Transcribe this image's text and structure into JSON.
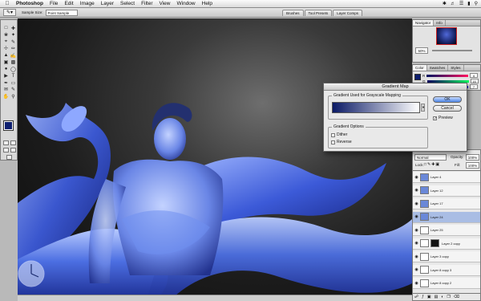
{
  "menubar": {
    "apple": "",
    "app_name": "Photoshop",
    "items": [
      "File",
      "Edit",
      "Image",
      "Layer",
      "Select",
      "Filter",
      "View",
      "Window",
      "Help"
    ]
  },
  "options_bar": {
    "sample_size_label": "Sample Size:",
    "sample_size_value": "Point Sample",
    "palette_wells": [
      "Brushes",
      "Tool Presets",
      "Layer Comps"
    ]
  },
  "navigator": {
    "tabs": [
      "Navigator",
      "Info"
    ],
    "zoom": "50%"
  },
  "color_panel": {
    "tabs": [
      "Color",
      "Swatches",
      "Styles"
    ],
    "channels": [
      {
        "label": "R",
        "value": "6"
      },
      {
        "label": "G",
        "value": "16"
      },
      {
        "label": "B",
        "value": "7"
      }
    ]
  },
  "layers_panel": {
    "tabs": [
      "Layers",
      "Channels",
      "Paths"
    ],
    "blend_mode": "Normal",
    "opacity_label": "Opacity:",
    "opacity_value": "100%",
    "lock_label": "Lock:",
    "fill_label": "Fill:",
    "fill_value": "100%",
    "layers": [
      {
        "name": "Layer 4",
        "selected": false
      },
      {
        "name": "Layer 12",
        "selected": false
      },
      {
        "name": "Layer 17",
        "selected": false
      },
      {
        "name": "Layer 24",
        "selected": true
      },
      {
        "name": "Layer 25",
        "selected": false
      },
      {
        "name": "Layer 2 copy",
        "selected": false
      },
      {
        "name": "Layer 3 copy",
        "selected": false
      },
      {
        "name": "Layer 8 copy 3",
        "selected": false
      },
      {
        "name": "Layer 8 copy 2",
        "selected": false
      }
    ]
  },
  "dialog": {
    "title": "Gradient Map",
    "gradient_group_label": "Gradient Used for Grayscale Mapping",
    "options_group_label": "Gradient Options",
    "dither_label": "Dither",
    "reverse_label": "Reverse",
    "ok_label": "OK",
    "cancel_label": "Cancel",
    "preview_label": "Preview",
    "preview_checked": true,
    "dither_checked": false,
    "reverse_checked": false,
    "gradient_start_color": "#0b1a66",
    "gradient_end_color": "#ffffff"
  },
  "colors": {
    "foreground": "#0d1e6e",
    "background": "#ffffff",
    "selection": "#a9bde4"
  }
}
